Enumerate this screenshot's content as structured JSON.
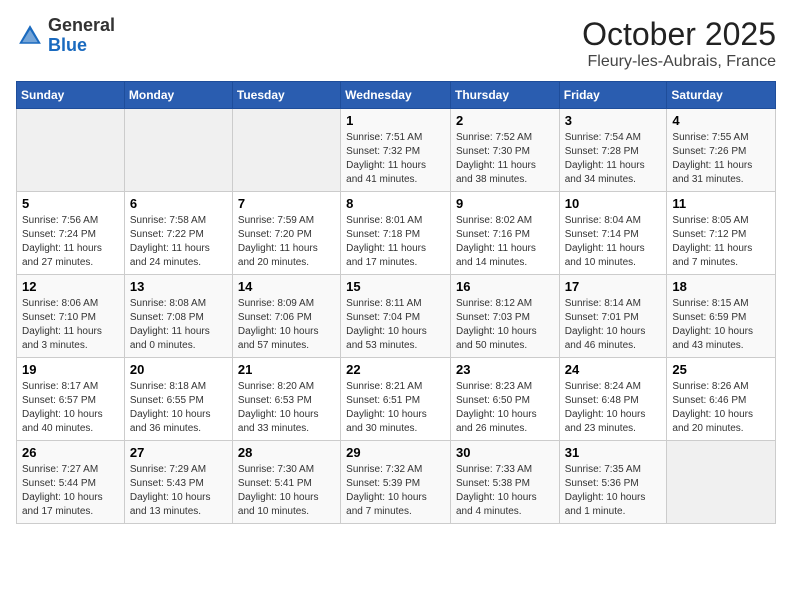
{
  "logo": {
    "general": "General",
    "blue": "Blue"
  },
  "title": "October 2025",
  "subtitle": "Fleury-les-Aubrais, France",
  "days_of_week": [
    "Sunday",
    "Monday",
    "Tuesday",
    "Wednesday",
    "Thursday",
    "Friday",
    "Saturday"
  ],
  "weeks": [
    [
      {
        "day": "",
        "info": ""
      },
      {
        "day": "",
        "info": ""
      },
      {
        "day": "",
        "info": ""
      },
      {
        "day": "1",
        "info": "Sunrise: 7:51 AM\nSunset: 7:32 PM\nDaylight: 11 hours and 41 minutes."
      },
      {
        "day": "2",
        "info": "Sunrise: 7:52 AM\nSunset: 7:30 PM\nDaylight: 11 hours and 38 minutes."
      },
      {
        "day": "3",
        "info": "Sunrise: 7:54 AM\nSunset: 7:28 PM\nDaylight: 11 hours and 34 minutes."
      },
      {
        "day": "4",
        "info": "Sunrise: 7:55 AM\nSunset: 7:26 PM\nDaylight: 11 hours and 31 minutes."
      }
    ],
    [
      {
        "day": "5",
        "info": "Sunrise: 7:56 AM\nSunset: 7:24 PM\nDaylight: 11 hours and 27 minutes."
      },
      {
        "day": "6",
        "info": "Sunrise: 7:58 AM\nSunset: 7:22 PM\nDaylight: 11 hours and 24 minutes."
      },
      {
        "day": "7",
        "info": "Sunrise: 7:59 AM\nSunset: 7:20 PM\nDaylight: 11 hours and 20 minutes."
      },
      {
        "day": "8",
        "info": "Sunrise: 8:01 AM\nSunset: 7:18 PM\nDaylight: 11 hours and 17 minutes."
      },
      {
        "day": "9",
        "info": "Sunrise: 8:02 AM\nSunset: 7:16 PM\nDaylight: 11 hours and 14 minutes."
      },
      {
        "day": "10",
        "info": "Sunrise: 8:04 AM\nSunset: 7:14 PM\nDaylight: 11 hours and 10 minutes."
      },
      {
        "day": "11",
        "info": "Sunrise: 8:05 AM\nSunset: 7:12 PM\nDaylight: 11 hours and 7 minutes."
      }
    ],
    [
      {
        "day": "12",
        "info": "Sunrise: 8:06 AM\nSunset: 7:10 PM\nDaylight: 11 hours and 3 minutes."
      },
      {
        "day": "13",
        "info": "Sunrise: 8:08 AM\nSunset: 7:08 PM\nDaylight: 11 hours and 0 minutes."
      },
      {
        "day": "14",
        "info": "Sunrise: 8:09 AM\nSunset: 7:06 PM\nDaylight: 10 hours and 57 minutes."
      },
      {
        "day": "15",
        "info": "Sunrise: 8:11 AM\nSunset: 7:04 PM\nDaylight: 10 hours and 53 minutes."
      },
      {
        "day": "16",
        "info": "Sunrise: 8:12 AM\nSunset: 7:03 PM\nDaylight: 10 hours and 50 minutes."
      },
      {
        "day": "17",
        "info": "Sunrise: 8:14 AM\nSunset: 7:01 PM\nDaylight: 10 hours and 46 minutes."
      },
      {
        "day": "18",
        "info": "Sunrise: 8:15 AM\nSunset: 6:59 PM\nDaylight: 10 hours and 43 minutes."
      }
    ],
    [
      {
        "day": "19",
        "info": "Sunrise: 8:17 AM\nSunset: 6:57 PM\nDaylight: 10 hours and 40 minutes."
      },
      {
        "day": "20",
        "info": "Sunrise: 8:18 AM\nSunset: 6:55 PM\nDaylight: 10 hours and 36 minutes."
      },
      {
        "day": "21",
        "info": "Sunrise: 8:20 AM\nSunset: 6:53 PM\nDaylight: 10 hours and 33 minutes."
      },
      {
        "day": "22",
        "info": "Sunrise: 8:21 AM\nSunset: 6:51 PM\nDaylight: 10 hours and 30 minutes."
      },
      {
        "day": "23",
        "info": "Sunrise: 8:23 AM\nSunset: 6:50 PM\nDaylight: 10 hours and 26 minutes."
      },
      {
        "day": "24",
        "info": "Sunrise: 8:24 AM\nSunset: 6:48 PM\nDaylight: 10 hours and 23 minutes."
      },
      {
        "day": "25",
        "info": "Sunrise: 8:26 AM\nSunset: 6:46 PM\nDaylight: 10 hours and 20 minutes."
      }
    ],
    [
      {
        "day": "26",
        "info": "Sunrise: 7:27 AM\nSunset: 5:44 PM\nDaylight: 10 hours and 17 minutes."
      },
      {
        "day": "27",
        "info": "Sunrise: 7:29 AM\nSunset: 5:43 PM\nDaylight: 10 hours and 13 minutes."
      },
      {
        "day": "28",
        "info": "Sunrise: 7:30 AM\nSunset: 5:41 PM\nDaylight: 10 hours and 10 minutes."
      },
      {
        "day": "29",
        "info": "Sunrise: 7:32 AM\nSunset: 5:39 PM\nDaylight: 10 hours and 7 minutes."
      },
      {
        "day": "30",
        "info": "Sunrise: 7:33 AM\nSunset: 5:38 PM\nDaylight: 10 hours and 4 minutes."
      },
      {
        "day": "31",
        "info": "Sunrise: 7:35 AM\nSunset: 5:36 PM\nDaylight: 10 hours and 1 minute."
      },
      {
        "day": "",
        "info": ""
      }
    ]
  ]
}
